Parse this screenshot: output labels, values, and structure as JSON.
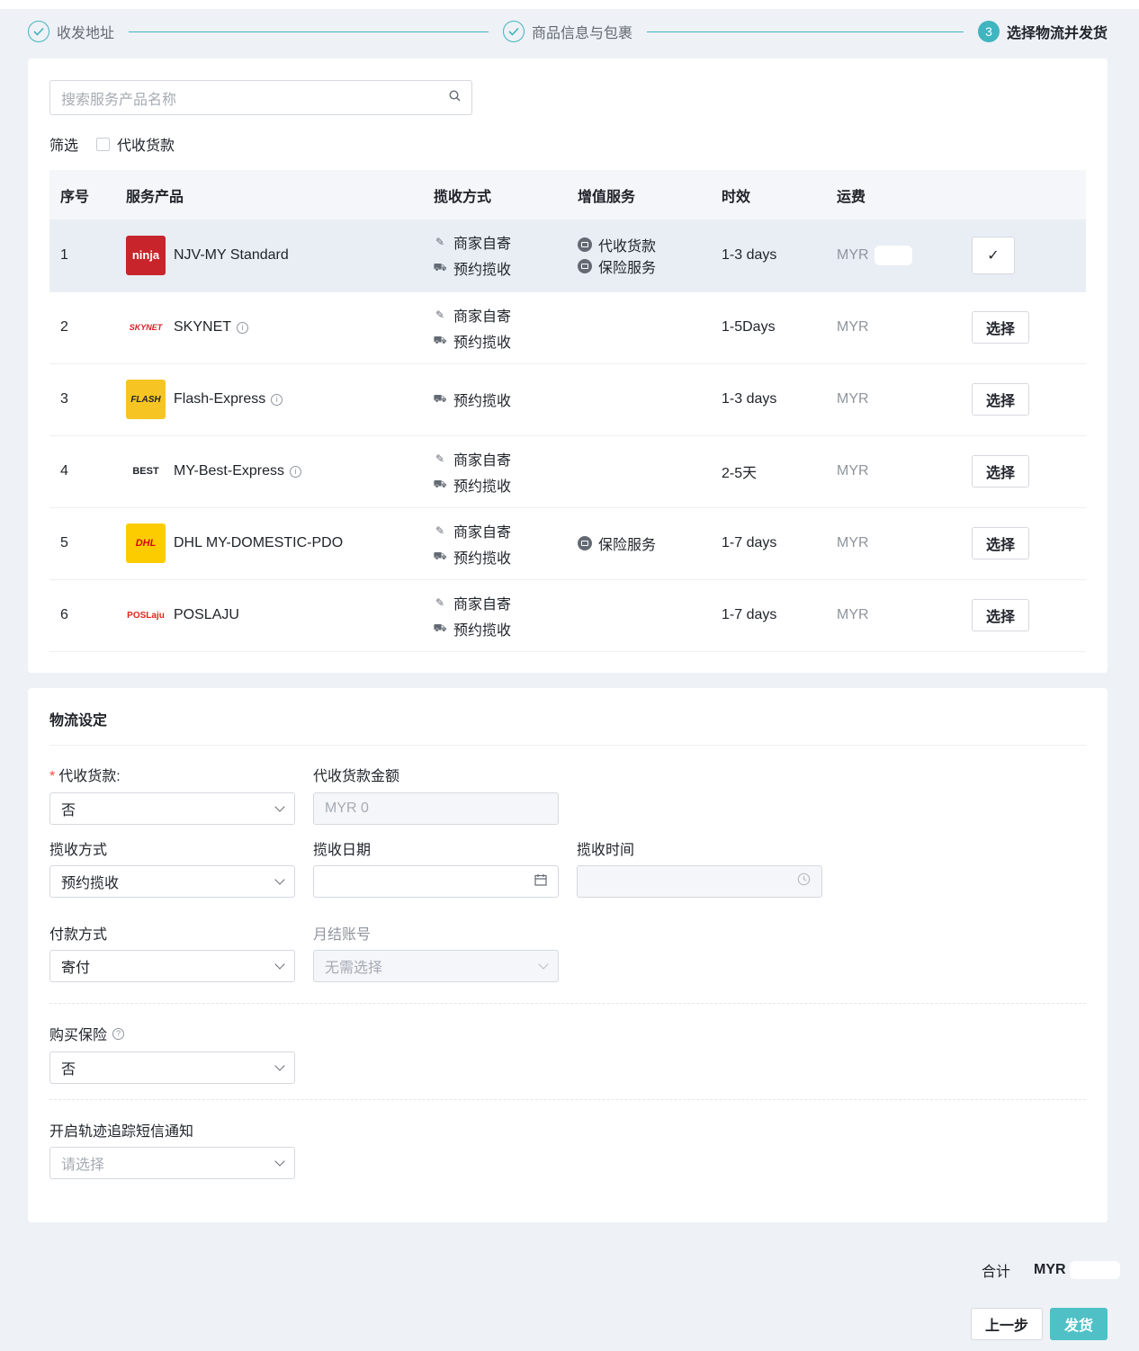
{
  "stepper": {
    "steps": [
      {
        "label": "收发地址",
        "state": "done"
      },
      {
        "label": "商品信息与包裹",
        "state": "done"
      },
      {
        "label": "选择物流并发货",
        "state": "active",
        "number": "3"
      }
    ],
    "accent": "#40b5bf"
  },
  "search": {
    "placeholder": "搜索服务产品名称"
  },
  "filter": {
    "label": "筛选",
    "cod_option": "代收货款"
  },
  "table": {
    "headers": [
      "序号",
      "服务产品",
      "揽收方式",
      "增值服务",
      "时效",
      "运费"
    ],
    "rows": [
      {
        "index": "1",
        "name": "NJV-MY Standard",
        "logo_text": "ninja",
        "info": false,
        "methods": [
          "商家自寄",
          "预约揽收"
        ],
        "services": [
          "代收货款",
          "保险服务"
        ],
        "time": "1-3 days",
        "currency": "MYR",
        "action": "✓",
        "selected": true
      },
      {
        "index": "2",
        "name": "SKYNET",
        "logo_text": "SKYNET",
        "info": true,
        "methods": [
          "商家自寄",
          "预约揽收"
        ],
        "services": [],
        "time": "1-5Days",
        "currency": "MYR",
        "action": "选择",
        "selected": false
      },
      {
        "index": "3",
        "name": "Flash-Express",
        "logo_text": "FLASH",
        "info": true,
        "methods": [
          "预约揽收"
        ],
        "services": [],
        "time": "1-3 days",
        "currency": "MYR",
        "action": "选择",
        "selected": false
      },
      {
        "index": "4",
        "name": "MY-Best-Express",
        "logo_text": "BEST",
        "info": true,
        "methods": [
          "商家自寄",
          "预约揽收"
        ],
        "services": [],
        "time": "2-5天",
        "currency": "MYR",
        "action": "选择",
        "selected": false
      },
      {
        "index": "5",
        "name": "DHL MY-DOMESTIC-PDO",
        "logo_text": "DHL",
        "info": false,
        "methods": [
          "商家自寄",
          "预约揽收"
        ],
        "services": [
          "保险服务"
        ],
        "time": "1-7 days",
        "currency": "MYR",
        "action": "选择",
        "selected": false
      },
      {
        "index": "6",
        "name": "POSLAJU",
        "logo_text": "POSLaju",
        "info": false,
        "methods": [
          "商家自寄",
          "预约揽收"
        ],
        "services": [],
        "time": "1-7 days",
        "currency": "MYR",
        "action": "选择",
        "selected": false
      }
    ]
  },
  "settings": {
    "title": "物流设定",
    "cod": {
      "label": "代收货款:",
      "value": "否"
    },
    "cod_amount": {
      "label": "代收货款金额",
      "value": "MYR 0"
    },
    "pickup_method": {
      "label": "揽收方式",
      "value": "预约揽收"
    },
    "pickup_date": {
      "label": "揽收日期",
      "value": ""
    },
    "pickup_time": {
      "label": "揽收时间",
      "value": ""
    },
    "payment": {
      "label": "付款方式",
      "value": "寄付"
    },
    "monthly_account": {
      "label": "月结账号",
      "placeholder": "无需选择"
    },
    "insurance": {
      "label": "购买保险",
      "value": "否"
    },
    "sms": {
      "label": "开启轨迹追踪短信通知",
      "placeholder": "请选择"
    }
  },
  "footer": {
    "total_label": "合计",
    "total_currency": "MYR",
    "prev_label": "上一步",
    "ship_label": "发货",
    "ship_color": "#4fc1c6"
  }
}
